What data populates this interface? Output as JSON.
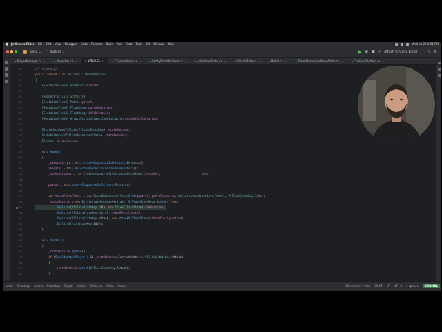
{
  "menubar": {
    "app_name": "JetBrains Rider",
    "items": [
      "File",
      "Edit",
      "View",
      "Navigate",
      "Code",
      "Refactor",
      "Build",
      "Run",
      "Tests",
      "Tools",
      "Git",
      "Window",
      "Help"
    ],
    "clock": "Wed Jul 22  2:51 PM"
  },
  "toolbar": {
    "project_badge": "U",
    "project_name": "unity",
    "branch": "master",
    "attach_label": "Attach to Unity Editor"
  },
  "tabs": [
    {
      "label": "PlayerManager.cs",
      "active": false
    },
    {
      "label": "Projectile.cs",
      "active": false
    },
    {
      "label": "Villain.cs",
      "active": true
    },
    {
      "label": "ChaseInWave.cs",
      "active": false
    },
    {
      "label": "EntityStateMachine.cs",
      "active": false
    },
    {
      "label": "IdleVillainState.cs",
      "active": false
    },
    {
      "label": "VillainState.cs",
      "active": false
    },
    {
      "label": "Patrol.cs",
      "active": false
    },
    {
      "label": "TimedBehaviourWaveState.cs",
      "active": false
    },
    {
      "label": "CollisionTestBed.cs",
      "active": false
    }
  ],
  "code": {
    "lines": [
      {
        "n": "14",
        "t": "/// <summary>"
      },
      {
        "n": "15",
        "t": "public sealed class Villain : MonoBehaviour"
      },
      {
        "n": "16",
        "t": "{"
      },
      {
        "n": "17",
        "t": "    [SerializeField] Animator animator;"
      },
      {
        "n": "18",
        "t": ""
      },
      {
        "n": "19",
        "t": "    [Header(\"Villain States\")]"
      },
      {
        "n": "20",
        "t": "    [SerializeField] Patrol patrol;"
      },
      {
        "n": "21",
        "t": "    [SerializeField] FloatRange patrolDuration;"
      },
      {
        "n": "22",
        "t": "    [SerializeField] FloatRange idleDuration;"
      },
      {
        "n": "23",
        "t": "    [SerializeField] AttackVillainState.Configuration attackConfiguration;"
      },
      {
        "n": "24",
        "t": ""
      },
      {
        "n": "25",
        "t": "    IStateMachine<Villain,VillainStateKey> _stateMachine;"
      },
      {
        "n": "26",
        "t": "    StateAnimator<VillainAnimationState> _stateAnimator;"
      },
      {
        "n": "27",
        "t": "    IAttack _attackScript;"
      },
      {
        "n": "28",
        "t": ""
      },
      {
        "n": "29",
        "t": "    void Awake()"
      },
      {
        "n": "30",
        "t": "    {"
      },
      {
        "n": "31",
        "t": "        _attackScript = this.AssertComponentInChildren<IAttack>();"
      },
      {
        "n": "32",
        "t": "        animator = this.AssertComponentInChildren<Animator>();"
      },
      {
        "n": "33",
        "t": "        _stateAnimator = new StateAnimator<VillainAnimationState>(animator,                         this);"
      },
      {
        "n": "34",
        "t": ""
      },
      {
        "n": "35",
        "t": "        patrol = this.AssertComponentInChildren<Patrol>();"
      },
      {
        "n": "36",
        "t": ""
      },
      {
        "n": "37",
        "t": "        var timedPatrolState = new TimedBehaviourVillainState(patrol, patrolDuration, VillainAnimationState.Patrol, VillainStateKey.Idle);"
      },
      {
        "n": "38",
        "t": "        _stateMachine = new EntityStateMachine<Villain, VillainStateKey>.Builder(this)"
      },
      {
        "n": "39",
        "t": "            .Register(VillainStateKey.Idle, new IdleVillainState(idleDuration))"
      },
      {
        "n": "40",
        "t": "            .Register(VillainStateKey.Patrol, timedPatrolState)"
      },
      {
        "n": "41",
        "t": "            .Register(VillainStateKey.Attack, new AttackVillainState(attackConfiguration))"
      },
      {
        "n": "42",
        "t": "            .Build(VillainStateKey.Idle);"
      },
      {
        "n": "43",
        "t": "    }"
      },
      {
        "n": "44",
        "t": ""
      },
      {
        "n": "45",
        "t": "    void Update()"
      },
      {
        "n": "46",
        "t": "    {"
      },
      {
        "n": "47",
        "t": "        _stateMachine.Update();"
      },
      {
        "n": "48",
        "t": "        if (ShouldAttackPlayer() && _stateMachine.CurrentState != VillainStateKey.Attack)"
      },
      {
        "n": "49",
        "t": "        {"
      },
      {
        "n": "50",
        "t": "            _stateMachine.Switch(VillainStateKey.Attack);"
      },
      {
        "n": "51",
        "t": "        }"
      }
    ]
  },
  "statusbar": {
    "breadcrumbs": [
      "unity",
      "Shanktop",
      "Assets",
      "Shanktop",
      "Scripts",
      "Villain",
      "Villain.cs",
      "Villain",
      "Awake"
    ],
    "problems": "18 errors in 3 files",
    "position": "39:57",
    "line_sep": "LF",
    "encoding": "UTF-8",
    "indent": "4 spaces",
    "mode": "NORMAL"
  },
  "colors": {
    "background": "#1e1f22",
    "panel": "#2b2d30",
    "accent": "#3574f0",
    "keyword": "#cf8e6d",
    "type": "#6fafbd",
    "method": "#56a8f5",
    "mode_badge": "#2f7d46"
  }
}
